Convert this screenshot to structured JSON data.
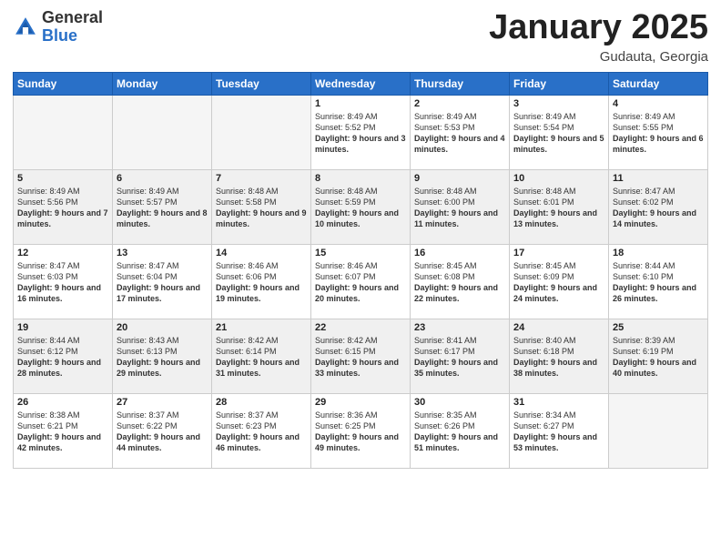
{
  "header": {
    "logo_general": "General",
    "logo_blue": "Blue",
    "month_title": "January 2025",
    "location": "Gudauta, Georgia"
  },
  "weekdays": [
    "Sunday",
    "Monday",
    "Tuesday",
    "Wednesday",
    "Thursday",
    "Friday",
    "Saturday"
  ],
  "weeks": [
    [
      {
        "day": "",
        "info": ""
      },
      {
        "day": "",
        "info": ""
      },
      {
        "day": "",
        "info": ""
      },
      {
        "day": "1",
        "info": "Sunrise: 8:49 AM\nSunset: 5:52 PM\nDaylight: 9 hours and 3 minutes."
      },
      {
        "day": "2",
        "info": "Sunrise: 8:49 AM\nSunset: 5:53 PM\nDaylight: 9 hours and 4 minutes."
      },
      {
        "day": "3",
        "info": "Sunrise: 8:49 AM\nSunset: 5:54 PM\nDaylight: 9 hours and 5 minutes."
      },
      {
        "day": "4",
        "info": "Sunrise: 8:49 AM\nSunset: 5:55 PM\nDaylight: 9 hours and 6 minutes."
      }
    ],
    [
      {
        "day": "5",
        "info": "Sunrise: 8:49 AM\nSunset: 5:56 PM\nDaylight: 9 hours and 7 minutes."
      },
      {
        "day": "6",
        "info": "Sunrise: 8:49 AM\nSunset: 5:57 PM\nDaylight: 9 hours and 8 minutes."
      },
      {
        "day": "7",
        "info": "Sunrise: 8:48 AM\nSunset: 5:58 PM\nDaylight: 9 hours and 9 minutes."
      },
      {
        "day": "8",
        "info": "Sunrise: 8:48 AM\nSunset: 5:59 PM\nDaylight: 9 hours and 10 minutes."
      },
      {
        "day": "9",
        "info": "Sunrise: 8:48 AM\nSunset: 6:00 PM\nDaylight: 9 hours and 11 minutes."
      },
      {
        "day": "10",
        "info": "Sunrise: 8:48 AM\nSunset: 6:01 PM\nDaylight: 9 hours and 13 minutes."
      },
      {
        "day": "11",
        "info": "Sunrise: 8:47 AM\nSunset: 6:02 PM\nDaylight: 9 hours and 14 minutes."
      }
    ],
    [
      {
        "day": "12",
        "info": "Sunrise: 8:47 AM\nSunset: 6:03 PM\nDaylight: 9 hours and 16 minutes."
      },
      {
        "day": "13",
        "info": "Sunrise: 8:47 AM\nSunset: 6:04 PM\nDaylight: 9 hours and 17 minutes."
      },
      {
        "day": "14",
        "info": "Sunrise: 8:46 AM\nSunset: 6:06 PM\nDaylight: 9 hours and 19 minutes."
      },
      {
        "day": "15",
        "info": "Sunrise: 8:46 AM\nSunset: 6:07 PM\nDaylight: 9 hours and 20 minutes."
      },
      {
        "day": "16",
        "info": "Sunrise: 8:45 AM\nSunset: 6:08 PM\nDaylight: 9 hours and 22 minutes."
      },
      {
        "day": "17",
        "info": "Sunrise: 8:45 AM\nSunset: 6:09 PM\nDaylight: 9 hours and 24 minutes."
      },
      {
        "day": "18",
        "info": "Sunrise: 8:44 AM\nSunset: 6:10 PM\nDaylight: 9 hours and 26 minutes."
      }
    ],
    [
      {
        "day": "19",
        "info": "Sunrise: 8:44 AM\nSunset: 6:12 PM\nDaylight: 9 hours and 28 minutes."
      },
      {
        "day": "20",
        "info": "Sunrise: 8:43 AM\nSunset: 6:13 PM\nDaylight: 9 hours and 29 minutes."
      },
      {
        "day": "21",
        "info": "Sunrise: 8:42 AM\nSunset: 6:14 PM\nDaylight: 9 hours and 31 minutes."
      },
      {
        "day": "22",
        "info": "Sunrise: 8:42 AM\nSunset: 6:15 PM\nDaylight: 9 hours and 33 minutes."
      },
      {
        "day": "23",
        "info": "Sunrise: 8:41 AM\nSunset: 6:17 PM\nDaylight: 9 hours and 35 minutes."
      },
      {
        "day": "24",
        "info": "Sunrise: 8:40 AM\nSunset: 6:18 PM\nDaylight: 9 hours and 38 minutes."
      },
      {
        "day": "25",
        "info": "Sunrise: 8:39 AM\nSunset: 6:19 PM\nDaylight: 9 hours and 40 minutes."
      }
    ],
    [
      {
        "day": "26",
        "info": "Sunrise: 8:38 AM\nSunset: 6:21 PM\nDaylight: 9 hours and 42 minutes."
      },
      {
        "day": "27",
        "info": "Sunrise: 8:37 AM\nSunset: 6:22 PM\nDaylight: 9 hours and 44 minutes."
      },
      {
        "day": "28",
        "info": "Sunrise: 8:37 AM\nSunset: 6:23 PM\nDaylight: 9 hours and 46 minutes."
      },
      {
        "day": "29",
        "info": "Sunrise: 8:36 AM\nSunset: 6:25 PM\nDaylight: 9 hours and 49 minutes."
      },
      {
        "day": "30",
        "info": "Sunrise: 8:35 AM\nSunset: 6:26 PM\nDaylight: 9 hours and 51 minutes."
      },
      {
        "day": "31",
        "info": "Sunrise: 8:34 AM\nSunset: 6:27 PM\nDaylight: 9 hours and 53 minutes."
      },
      {
        "day": "",
        "info": ""
      }
    ]
  ]
}
